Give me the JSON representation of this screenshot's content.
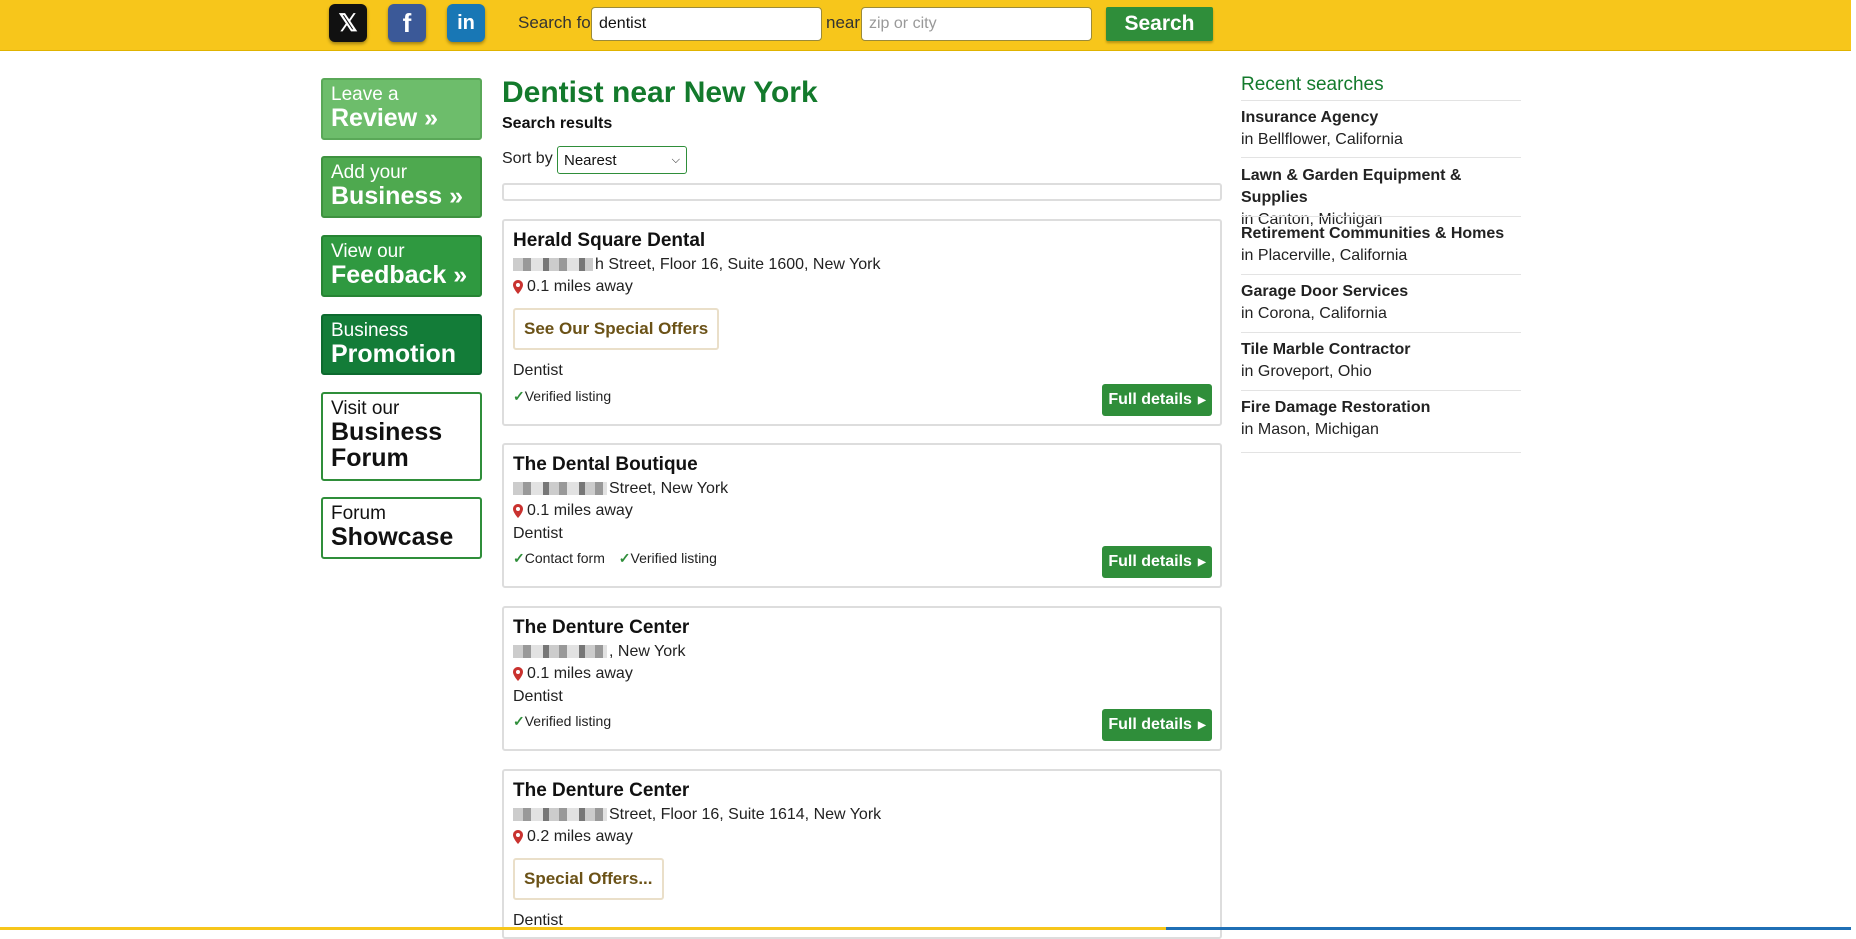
{
  "header": {
    "social": [
      {
        "name": "x",
        "glyph": "𝕏"
      },
      {
        "name": "facebook",
        "glyph": "f"
      },
      {
        "name": "linkedin",
        "glyph": "in"
      }
    ],
    "search_for_label": "Search for",
    "search_value": "dentist",
    "near_label": "near",
    "near_placeholder": "zip or city",
    "search_button": "Search"
  },
  "sidebar": [
    {
      "small": "Leave a",
      "big": "Review »"
    },
    {
      "small": "Add your",
      "big": "Business »"
    },
    {
      "small": "View our",
      "big": "Feedback »"
    },
    {
      "small": "Business",
      "big": "Promotion »"
    },
    {
      "small": "Visit our",
      "big": "Business",
      "big2": "Forum"
    },
    {
      "small": "Forum",
      "big": "Showcase"
    }
  ],
  "main": {
    "title": "Dentist near New York",
    "subtitle": "Search results",
    "sort_label": "Sort by",
    "sort_value": "Nearest",
    "results": [
      {
        "name": "Herald Square Dental",
        "address": "h Street, Floor 16, Suite 1600, New York",
        "distance": "0.1 miles away",
        "offer": "See Our Special Offers",
        "category": "Dentist",
        "badges": [
          "Verified listing"
        ],
        "button": "Full details"
      },
      {
        "name": "The Dental Boutique",
        "address": "Street, New York",
        "distance": "0.1 miles away",
        "category": "Dentist",
        "badges": [
          "Contact form",
          "Verified listing"
        ],
        "button": "Full details"
      },
      {
        "name": "The Denture Center",
        "address": ", New York",
        "distance": "0.1 miles away",
        "category": "Dentist",
        "badges": [
          "Verified listing"
        ],
        "button": "Full details"
      },
      {
        "name": "The Denture Center",
        "address": "Street, Floor 16, Suite 1614, New York",
        "distance": "0.2 miles away",
        "offer": "Special Offers...",
        "category": "Dentist"
      }
    ]
  },
  "recent": {
    "title": "Recent searches",
    "items": [
      {
        "term": "Insurance Agency",
        "location": "in Bellflower, California"
      },
      {
        "term": "Lawn & Garden Equipment & Supplies",
        "location": "in Canton, Michigan"
      },
      {
        "term": "Retirement Communities & Homes",
        "location": "in Placerville, California"
      },
      {
        "term": "Garage Door Services",
        "location": "in Corona, California"
      },
      {
        "term": "Tile Marble Contractor",
        "location": "in Groveport, Ohio"
      },
      {
        "term": "Fire Damage Restoration",
        "location": "in Mason, Michigan"
      }
    ]
  },
  "colors": {
    "topbar": "#f7c61b",
    "green": "#2f8e3a",
    "title_green": "#137a2c"
  }
}
